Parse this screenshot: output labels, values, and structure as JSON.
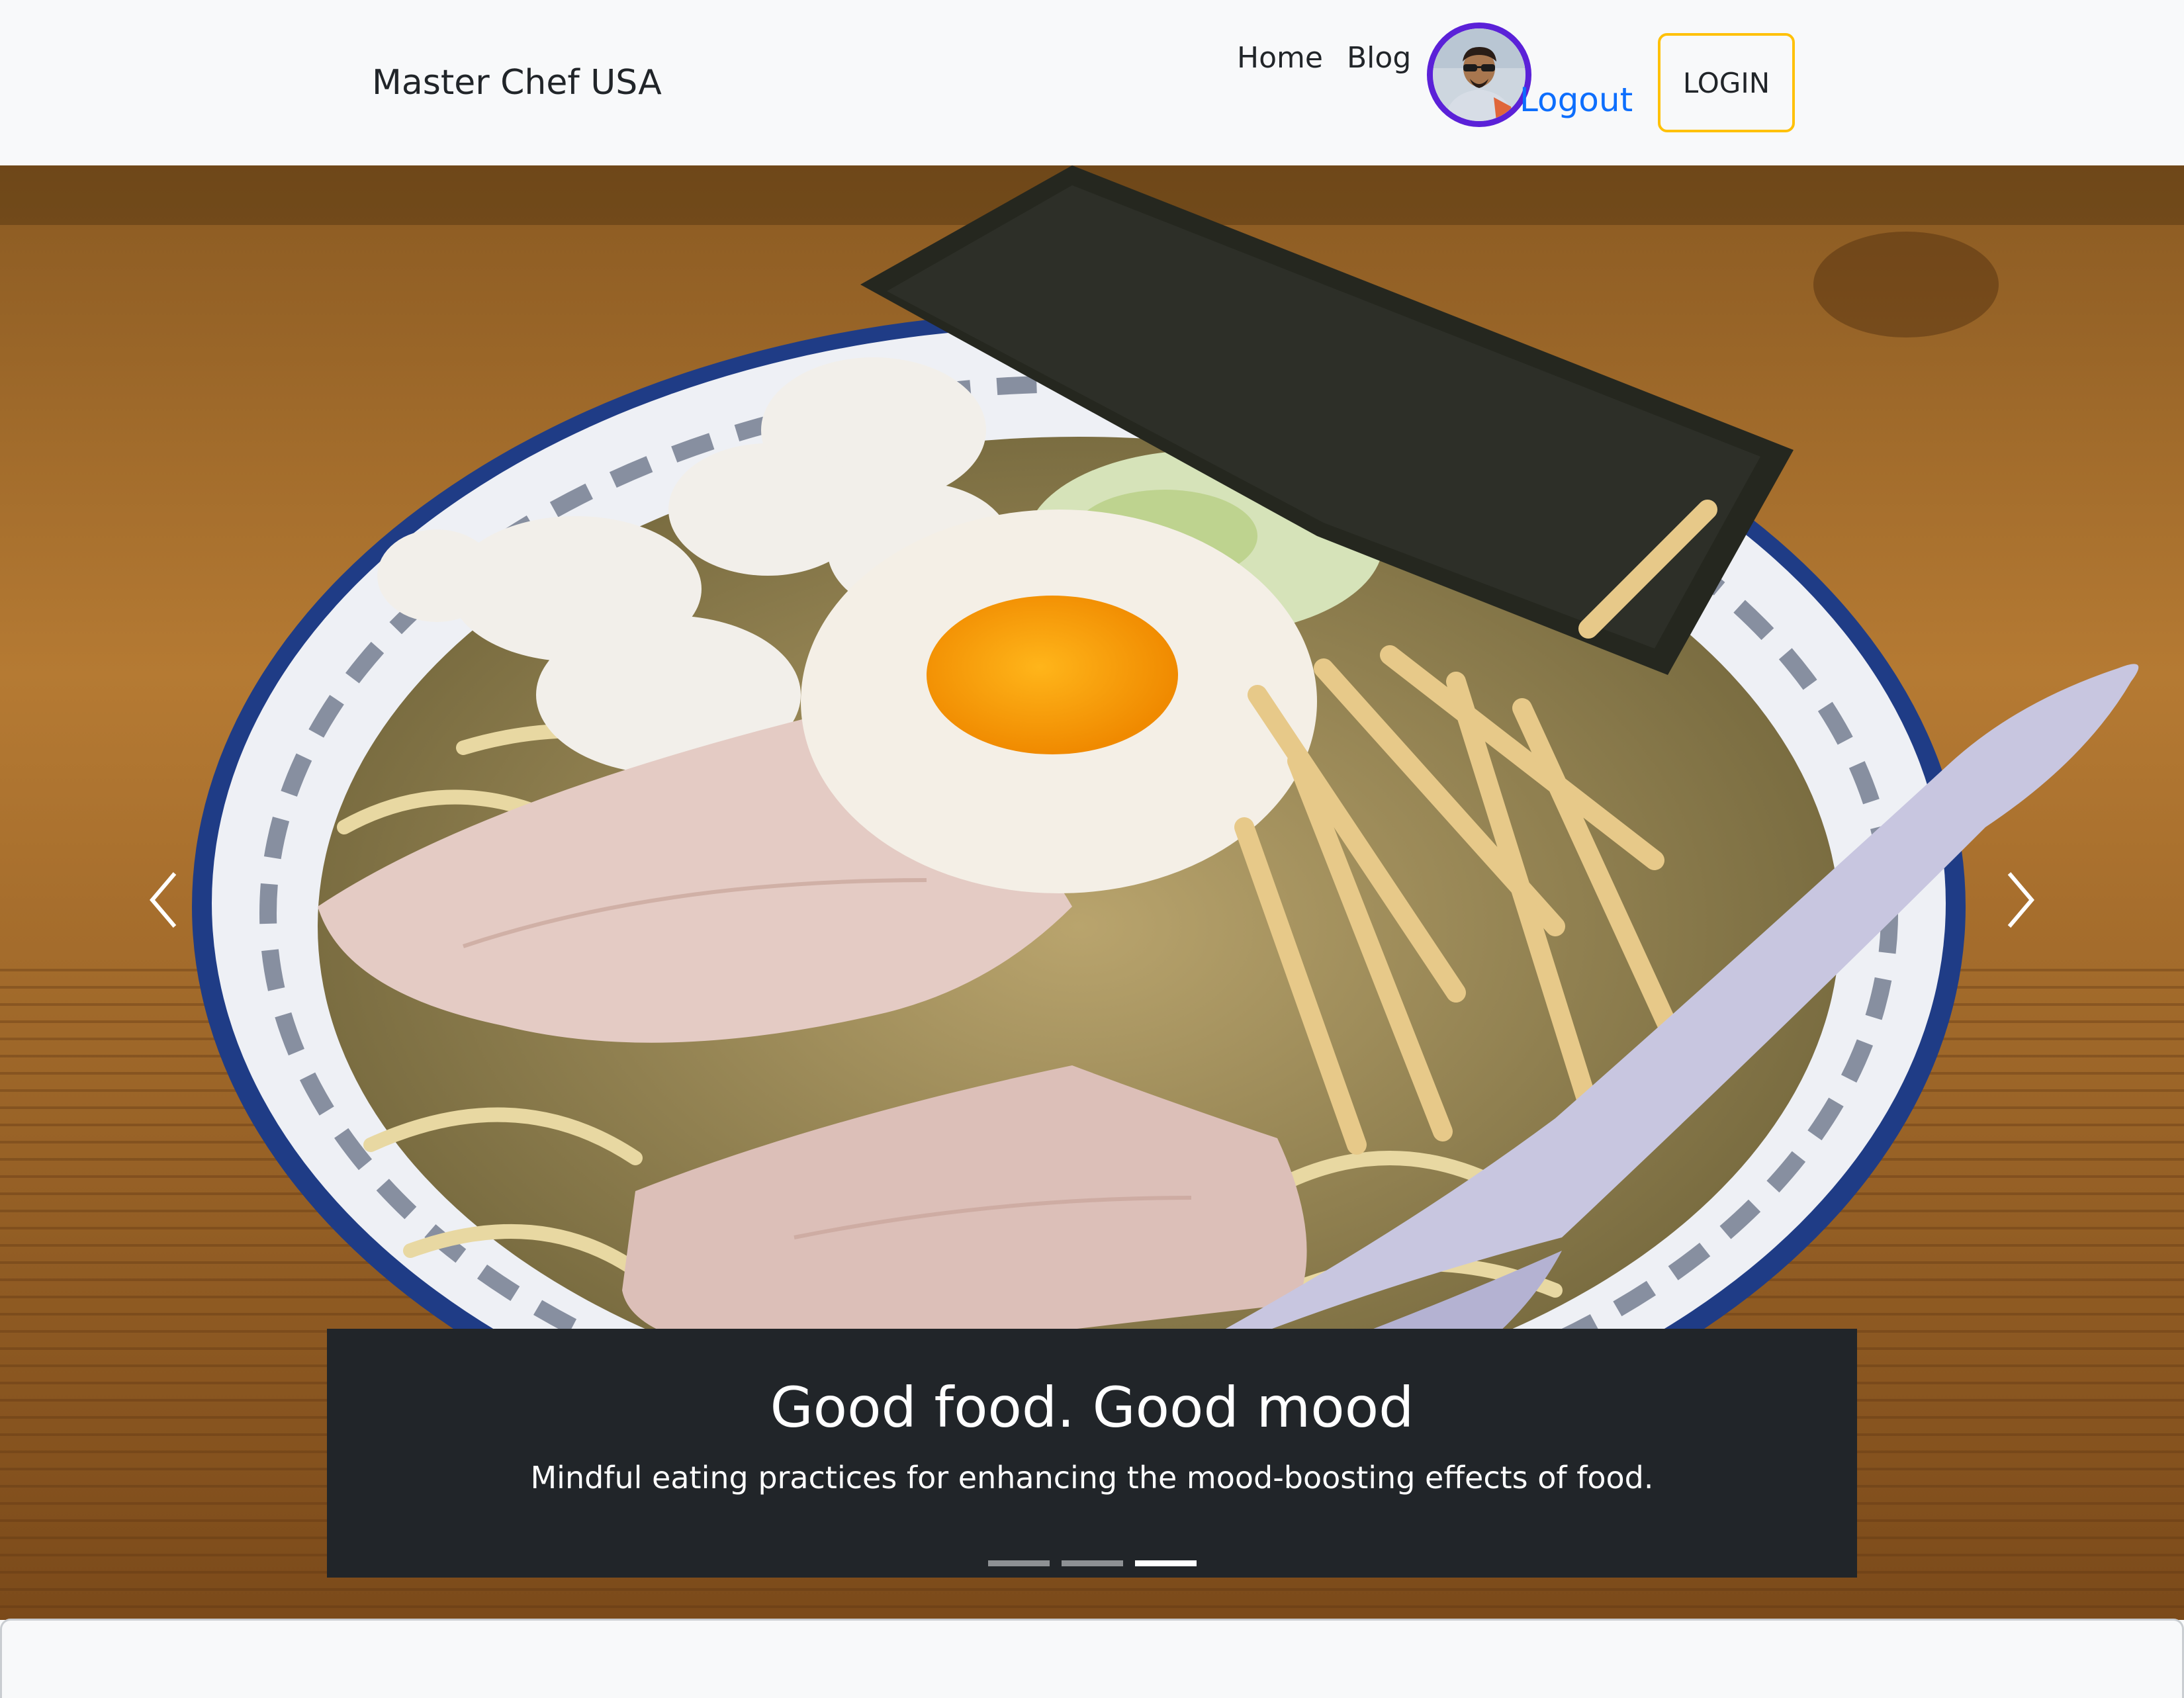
{
  "navbar": {
    "brand": "Master Chef USA",
    "links": [
      {
        "label": "Home"
      },
      {
        "label": "Blog"
      }
    ],
    "logout_label": "Logout",
    "login_label": "LOGIN",
    "avatar_ring_color": "#5b21d8"
  },
  "carousel": {
    "active_index": 2,
    "slide_count": 3,
    "slide_image": "ramen-bowl-photo",
    "caption_title": "Good food. Good mood",
    "caption_text": "Mindful eating practices for enhancing the mood-boosting effects of food.",
    "prev_icon": "chevron-left-icon",
    "next_icon": "chevron-right-icon"
  },
  "colors": {
    "accent_link": "#0d6efd",
    "login_border": "#ffc107",
    "caption_bg": "#212529"
  }
}
